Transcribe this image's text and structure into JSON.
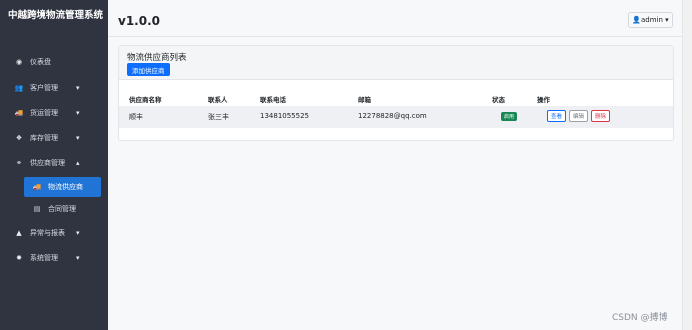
{
  "sidebar": {
    "brand": "中越跨境物流管理系统",
    "items": [
      {
        "label": "仪表盘",
        "icon": "dashboard-icon",
        "glyph": "◉"
      },
      {
        "label": "客户管理",
        "icon": "users-icon",
        "glyph": "👥",
        "chevron": "▾"
      },
      {
        "label": "货运管理",
        "icon": "truck-icon",
        "glyph": "🚚",
        "chevron": "▾"
      },
      {
        "label": "库存管理",
        "icon": "warehouse-icon",
        "glyph": "❖",
        "chevron": "▾"
      },
      {
        "label": "供应商管理",
        "icon": "handshake-icon",
        "glyph": "⚭",
        "chevron": "▴"
      },
      {
        "label": "物流供应商",
        "icon": "truck-icon",
        "glyph": "🚚",
        "active": true
      },
      {
        "label": "合同管理",
        "icon": "file-icon",
        "glyph": "▤"
      },
      {
        "label": "异常与报表",
        "icon": "warning-icon",
        "glyph": "▲",
        "chevron": "▾"
      },
      {
        "label": "系统管理",
        "icon": "gear-icon",
        "glyph": "✹",
        "chevron": "▾"
      }
    ]
  },
  "header": {
    "version": "v1.0.0",
    "user": "👤admin ▾"
  },
  "card": {
    "title": "物流供应商列表",
    "add_button": "添加供应商"
  },
  "table": {
    "headers": [
      "供应商名称",
      "联系人",
      "联系电话",
      "邮箱",
      "状态",
      "操作"
    ],
    "rows": [
      {
        "name": "顺丰",
        "contact": "张三丰",
        "phone": "13481055525",
        "email": "12278828@qq.com",
        "status": "启用",
        "actions": {
          "view": "查看",
          "edit": "编辑",
          "delete": "删除"
        }
      }
    ]
  },
  "watermark": "CSDN @搏博",
  "colors": {
    "sidebar": "#2f3440",
    "active": "#1f74d5",
    "primary": "#0d6efd",
    "success": "#198754",
    "danger": "#dc3545"
  }
}
